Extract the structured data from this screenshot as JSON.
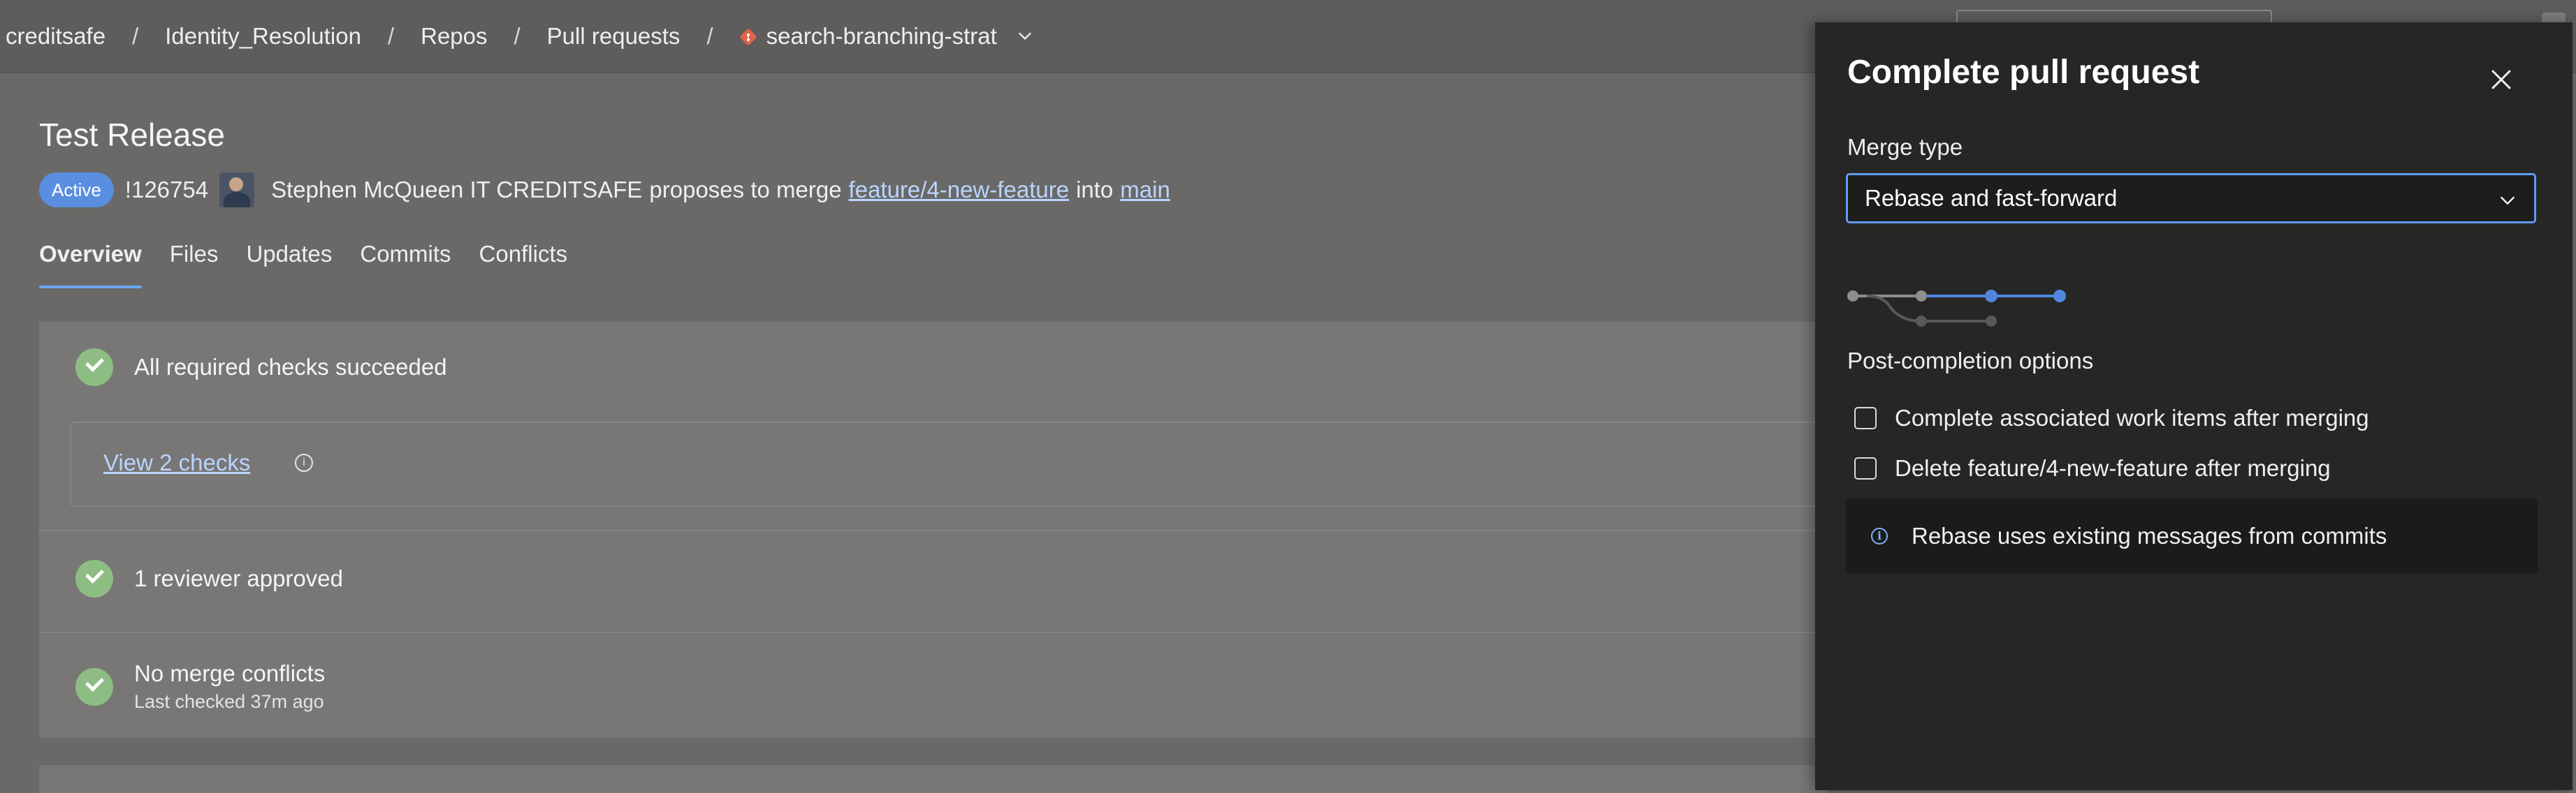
{
  "breadcrumb": {
    "items": [
      "creditsafe",
      "Identity_Resolution",
      "Repos",
      "Pull requests"
    ],
    "branch": "search-branching-strat",
    "separator": "/"
  },
  "pr": {
    "title": "Test Release",
    "status": "Active",
    "id": "!126754",
    "author": "Stephen McQueen IT CREDITSAFE",
    "proposes_text": "proposes to merge",
    "source_branch": "feature/4-new-feature",
    "into_text": "into",
    "target_branch": "main"
  },
  "tabs": [
    "Overview",
    "Files",
    "Updates",
    "Commits",
    "Conflicts"
  ],
  "active_tab": "Overview",
  "checks": {
    "all_required": "All required checks succeeded",
    "view_link": "View 2 checks",
    "reviewers": "1 reviewer approved",
    "merge_conflicts": "No merge conflicts",
    "last_checked": "Last checked 37m ago"
  },
  "panel": {
    "title": "Complete pull request",
    "merge_type_label": "Merge type",
    "merge_type_value": "Rebase and fast-forward",
    "post_completion_label": "Post-completion options",
    "options": [
      "Complete associated work items after merging",
      "Delete feature/4-new-feature after merging"
    ],
    "info_message": "Rebase uses existing messages from commits"
  },
  "icons": {
    "branch": "git-branch-icon",
    "chevron": "chevron-down-icon",
    "close": "close-icon",
    "check": "check-circle-icon",
    "info": "info-icon"
  },
  "colors": {
    "accent": "#5e9cf2",
    "badge_active": "#5a8ee0",
    "success": "#8dbd82",
    "branch_icon": "#e0644a",
    "link": "#b9d4ff"
  }
}
